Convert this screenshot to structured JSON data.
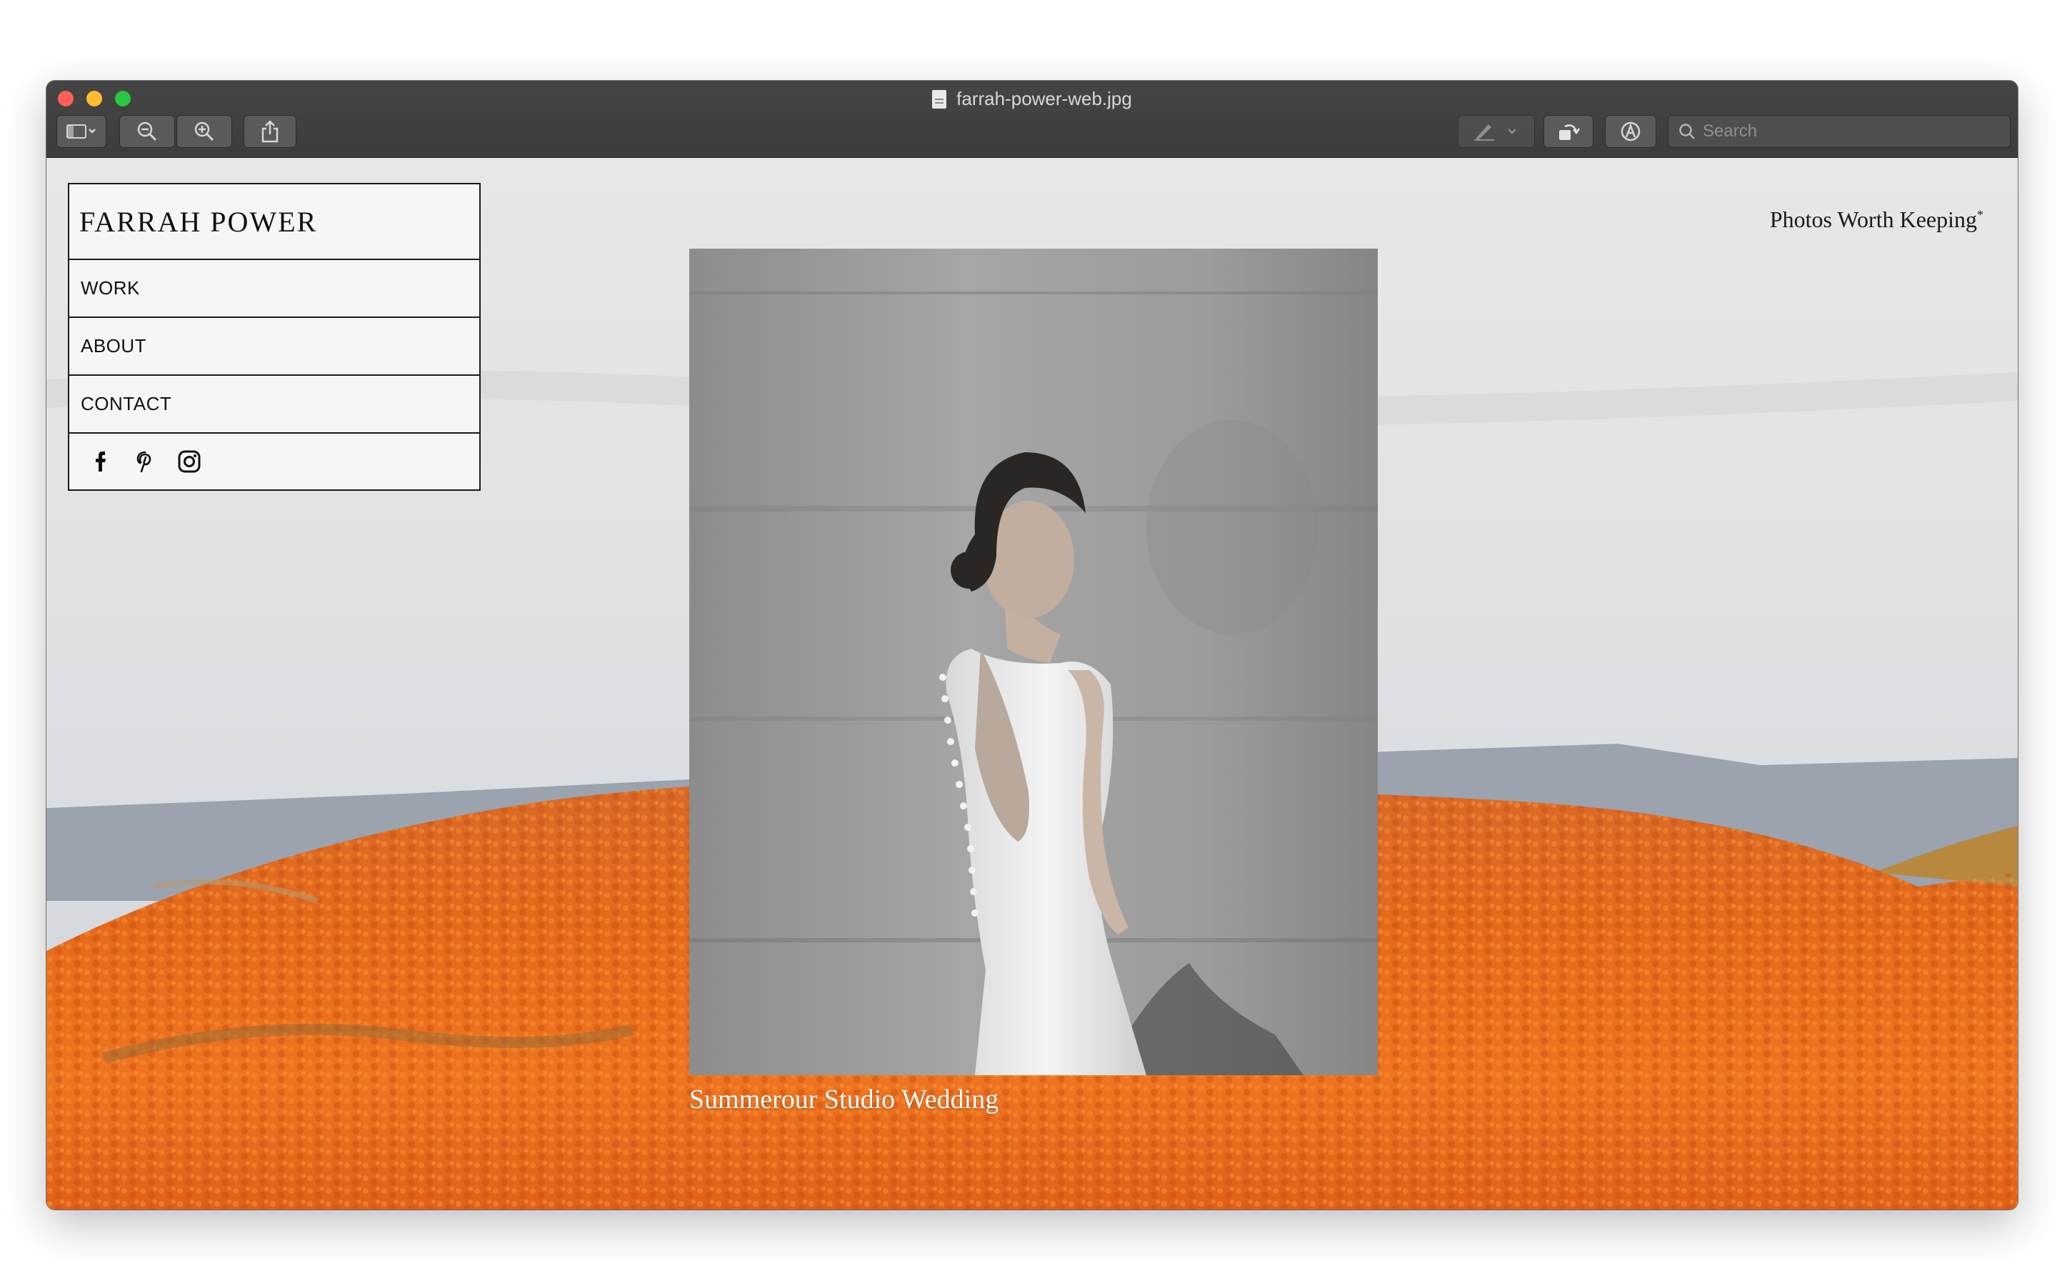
{
  "window": {
    "title": "farrah-power-web.jpg"
  },
  "toolbar": {
    "sidebar_icon": "sidebar-icon",
    "zoom_out_icon": "zoom-out-icon",
    "zoom_in_icon": "zoom-in-icon",
    "share_icon": "share-icon",
    "markup_icon": "pen-icon",
    "rotate_icon": "rotate-icon",
    "annotate_icon": "annotate-icon",
    "search_placeholder": "Search"
  },
  "site": {
    "brand": "FARRAH POWER",
    "nav": [
      "WORK",
      "ABOUT",
      "CONTACT"
    ],
    "socials": [
      "facebook-icon",
      "pinterest-icon",
      "instagram-icon"
    ],
    "tagline": "Photos Worth Keeping",
    "tagline_mark": "*",
    "caption": "Summerour Studio Wedding"
  },
  "colors": {
    "poppy": "#ec6b1c",
    "titlebar": "#3c3c3c"
  }
}
